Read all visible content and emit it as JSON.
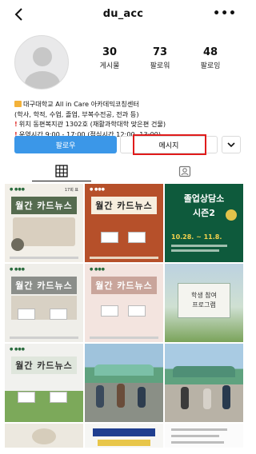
{
  "header": {
    "username": "du_acc",
    "more": "•••"
  },
  "stats": [
    {
      "count": "30",
      "label": "게시물"
    },
    {
      "count": "73",
      "label": "팔로워"
    },
    {
      "count": "48",
      "label": "팔로잉"
    }
  ],
  "bio": {
    "line1": "대구대학교 All in Care 아카데믹코칭센터",
    "line2": "(학사, 학적, 수업, 졸업, 부복수전공, 전과 등)",
    "line3": "위치 동편복지관 1302호 (재활과학대학 맞은편 건물)",
    "line4": "운영시간 9:00 - 17:00 (점심시간 12:00 -13:00)"
  },
  "buttons": {
    "follow": "팔로우",
    "message": "메시지",
    "dropdown": "⌄"
  },
  "posts": {
    "monthly_card": "월간 카드뉴스",
    "graduation": "졸업상담소",
    "graduation_sub": "시즌2",
    "graduation_dates": "10.28. ~ 11.8.",
    "student": "학생 참여",
    "program": "프로그램",
    "tag_17": "17회 표"
  },
  "colors": {
    "accent": "#3b97e8",
    "highlight": "#e01b1b",
    "graduation_bg": "#0e5a3c"
  }
}
